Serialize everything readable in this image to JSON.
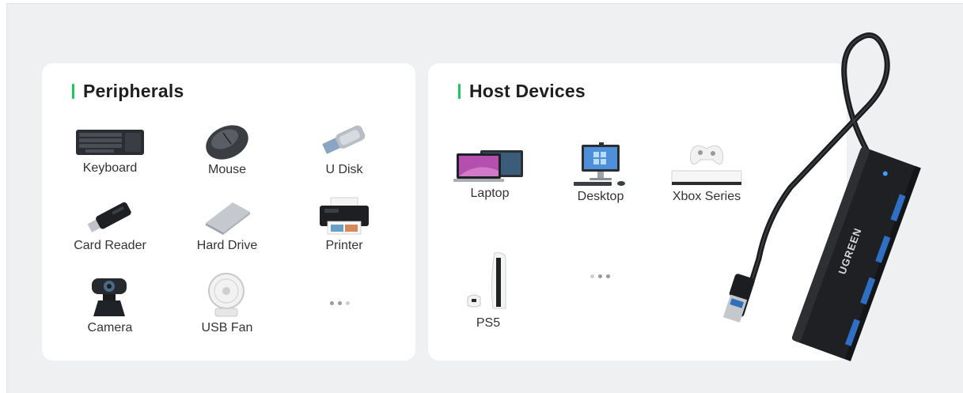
{
  "peripherals": {
    "title": "Peripherals",
    "items": [
      {
        "label": "Keyboard",
        "icon": "keyboard-icon"
      },
      {
        "label": "Mouse",
        "icon": "mouse-icon"
      },
      {
        "label": "U Disk",
        "icon": "usb-flash-drive-icon"
      },
      {
        "label": "Card Reader",
        "icon": "card-reader-icon"
      },
      {
        "label": "Hard Drive",
        "icon": "hard-drive-icon"
      },
      {
        "label": "Printer",
        "icon": "printer-icon"
      },
      {
        "label": "Camera",
        "icon": "webcam-icon"
      },
      {
        "label": "USB Fan",
        "icon": "usb-fan-icon"
      }
    ]
  },
  "host_devices": {
    "title": "Host Devices",
    "items": [
      {
        "label": "Laptop",
        "icon": "laptop-icon"
      },
      {
        "label": "Desktop",
        "icon": "desktop-icon"
      },
      {
        "label": "Xbox Series",
        "icon": "xbox-console-icon"
      },
      {
        "label": "PS5",
        "icon": "ps5-console-icon"
      }
    ]
  },
  "product": {
    "brand_text": "UGREEN",
    "icon": "usb-hub-image"
  },
  "colors": {
    "accent": "#22c55e",
    "card": "#ffffff",
    "background": "#eef0f2"
  }
}
